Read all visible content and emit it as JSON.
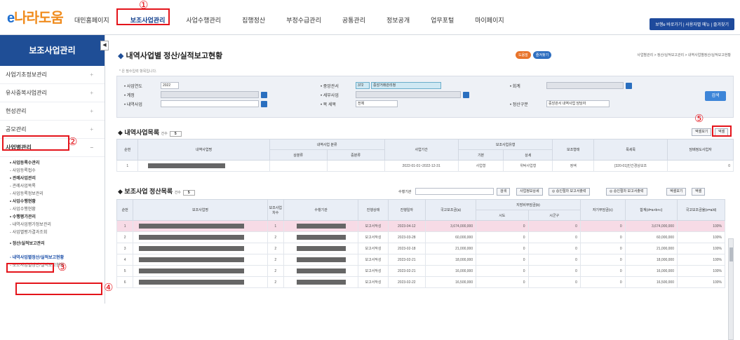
{
  "logo": {
    "brand_a": "e",
    "brand_b": "나라도움"
  },
  "gnb": [
    "대민홈페이지",
    "보조사업관리",
    "사업수행관리",
    "집행정산",
    "부정수급관리",
    "공통관리",
    "정보공개",
    "업무포털",
    "마이페이지"
  ],
  "toplinks": "보행e 바로가기 | 사용자별 메뉴 | 즐겨찾기",
  "markers": [
    "①",
    "②",
    "③",
    "④",
    "⑤"
  ],
  "sidebar": {
    "title": "보조사업관리",
    "toggle": "◀",
    "items": [
      {
        "label": "사업기초정보관리",
        "plus": "+"
      },
      {
        "label": "유사중복사업관리",
        "plus": "+"
      },
      {
        "label": "현성관리",
        "plus": "+"
      },
      {
        "label": "공모관리",
        "plus": "+"
      },
      {
        "label": "사업별관리",
        "plus": "−"
      }
    ],
    "subs": [
      "• 사업등록수관리",
      "- 사업등록접수",
      "• 관례사업관리",
      "- 관례사업목록",
      "- 사업등록정보관리",
      "• 사업수행현황",
      "- 사업수행현황",
      "• 수행평가관리",
      "- 내역사업평가정보관리",
      "- 사업별평가결과조회",
      "• 정산/실적보고관리",
      "- 내역사업별정산/실적보고현황",
      "- 보조사업별정산/실적보고현황"
    ]
  },
  "page": {
    "title": "내역사업별 정산/실적보고현황",
    "badges": [
      "도움말",
      "즐겨찾기"
    ],
    "badge_colors": [
      "#e8742b",
      "#2f6fc0"
    ],
    "breadcrumb": "사업별관리 > 정산/실적보고관리 > 내역사업별정산/실적보고현황",
    "note": "* 은 필수입력 항목입니다."
  },
  "search": {
    "year_label": "• 사업연도",
    "year_value": "2022",
    "account_label": "• 계정",
    "detail_label": "• 내역사업",
    "ministry_label": "• 중앙관서",
    "ministry_code": "372",
    "ministry_name": "중앙거래관리청",
    "subbiz_label": "• 세부사업",
    "item_label": "• 목 세목",
    "item_value": "전체",
    "fiscal_label": "• 회계",
    "standard_label": "• 정산구분",
    "standard_value": "중앙관서 내역사업 담당자",
    "find_button": "검색"
  },
  "detail_section": {
    "title": "내역사업목록",
    "per_page_label": "건수",
    "per_page": "5",
    "buttons": [
      "엑셀보기",
      "엑셀"
    ],
    "headers": [
      "순번",
      "내역사업명",
      "내역사업 분류",
      "상분류",
      "중분류",
      "사업기간",
      "보조사업유형",
      "기본",
      "상세",
      "보조형태",
      "목세목",
      "담배정도사업자"
    ],
    "row": {
      "no": "1",
      "period": "2022-01-01~2022-12-31",
      "type": "사업형",
      "detail": "위탁사업형",
      "form": "정액",
      "item": "[320-01]민간경상보조",
      "last": "0"
    }
  },
  "settle_section": {
    "title": "보조사업 정산목록",
    "per_page_label": "건수",
    "per_page": "5",
    "agency_label": "수행기관",
    "buttons": [
      "검색",
      "사업정보상세",
      "◎ 승인절차 보고서출력",
      "◎ 승인절차 보고서출력",
      "엑셀보기",
      "엑셀"
    ],
    "headers": [
      "순번",
      "보조사업명",
      "보조사업차수",
      "수행기관",
      "진행상태",
      "진행일자",
      "국고보조금(a)",
      "지방비부담금(b)",
      "시도",
      "시군구",
      "자기부담금(c)",
      "합계(d=a+b+c)",
      "국고보조금율(e=a/d)"
    ],
    "rows": [
      {
        "no": "1",
        "round": "1",
        "status": "보고서작성",
        "date": "2023-04-12",
        "gov": "3,674,000,000",
        "sido": "0",
        "sigungu": "0",
        "self": "0",
        "total": "3,674,000,000",
        "rate": "100%"
      },
      {
        "no": "2",
        "round": "2",
        "status": "보고서작성",
        "date": "2023-03-28",
        "gov": "60,000,000",
        "sido": "0",
        "sigungu": "0",
        "self": "0",
        "total": "60,000,000",
        "rate": "100%"
      },
      {
        "no": "3",
        "round": "2",
        "status": "보고서작성",
        "date": "2023-02-18",
        "gov": "21,000,000",
        "sido": "0",
        "sigungu": "0",
        "self": "0",
        "total": "21,000,000",
        "rate": "100%"
      },
      {
        "no": "4",
        "round": "2",
        "status": "보고서작성",
        "date": "2023-02-21",
        "gov": "18,000,000",
        "sido": "0",
        "sigungu": "0",
        "self": "0",
        "total": "18,000,000",
        "rate": "100%"
      },
      {
        "no": "5",
        "round": "2",
        "status": "보고서작성",
        "date": "2023-02-21",
        "gov": "16,000,000",
        "sido": "0",
        "sigungu": "0",
        "self": "0",
        "total": "16,000,000",
        "rate": "100%"
      },
      {
        "no": "6",
        "round": "2",
        "status": "보고서작성",
        "date": "2023-02-22",
        "gov": "16,500,000",
        "sido": "0",
        "sigungu": "0",
        "self": "0",
        "total": "16,500,000",
        "rate": "100%"
      }
    ]
  }
}
